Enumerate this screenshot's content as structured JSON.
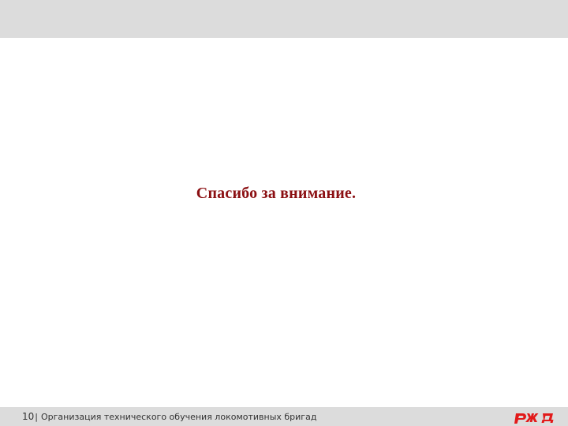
{
  "slide": {
    "title_text": "Спасибо за внимание."
  },
  "footer": {
    "page_number": "10",
    "separator": "|",
    "caption": "Организация технического обучения локомотивных бригад"
  },
  "logo": {
    "icon": "rzd-logo-icon",
    "color": "#e21a1a"
  },
  "colors": {
    "title": "#8b0f12",
    "band": "#dcdcdc",
    "background": "#ffffff"
  }
}
